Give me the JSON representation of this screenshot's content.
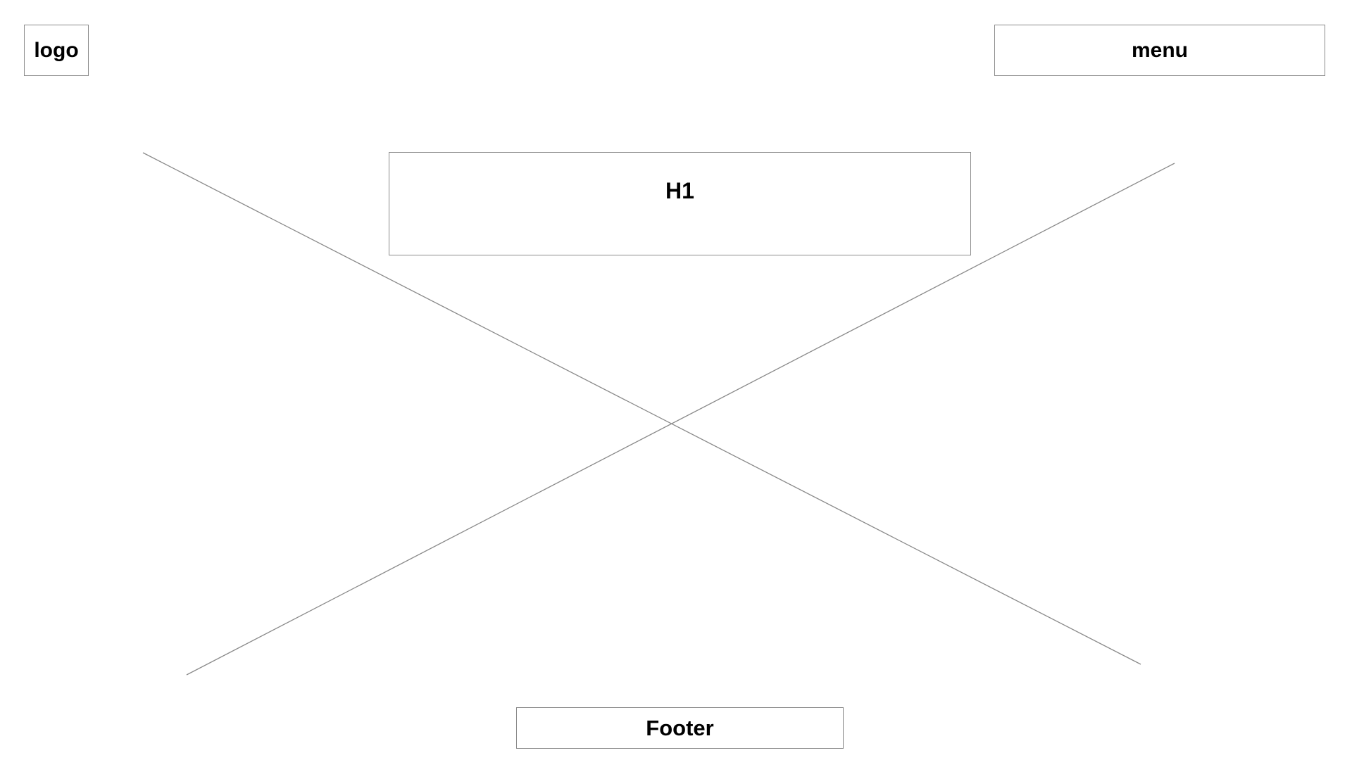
{
  "header": {
    "logo_label": "logo",
    "menu_label": "menu"
  },
  "main": {
    "heading_label": "H1",
    "image_placeholder": "image-placeholder-cross"
  },
  "footer": {
    "label": "Footer"
  },
  "colors": {
    "border": "#8a8a8a",
    "text": "#000000",
    "background": "#ffffff"
  }
}
